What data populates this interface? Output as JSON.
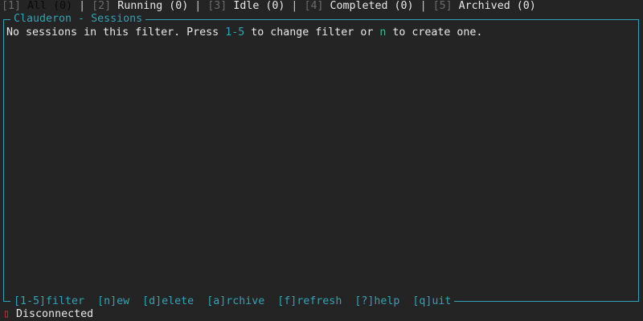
{
  "tabs": [
    {
      "key": "[1]",
      "label": "All (0)",
      "active": true
    },
    {
      "key": "[2]",
      "label": "Running (0)",
      "active": false
    },
    {
      "key": "[3]",
      "label": "Idle (0)",
      "active": false
    },
    {
      "key": "[4]",
      "label": "Completed (0)",
      "active": false
    },
    {
      "key": "[5]",
      "label": "Archived (0)",
      "active": false
    }
  ],
  "tab_separator": "|",
  "panel": {
    "title": "Clauderon - Sessions",
    "empty_message": {
      "part1": "No sessions in this filter. Press ",
      "range": "1-5",
      "part2": " to change filter or ",
      "create_key": "n",
      "part3": " to create one."
    }
  },
  "shortcuts": [
    "[1-5]filter",
    "[n]ew",
    "[d]elete",
    "[a]rchive",
    "[f]refresh",
    "[?]help",
    "[q]uit"
  ],
  "status": {
    "icon": "disconnected-icon",
    "text": "Disconnected"
  },
  "colors": {
    "accent": "#2fa3b8",
    "accent_green": "#3fb88a",
    "error": "#cc3b3b",
    "background": "#242424"
  }
}
